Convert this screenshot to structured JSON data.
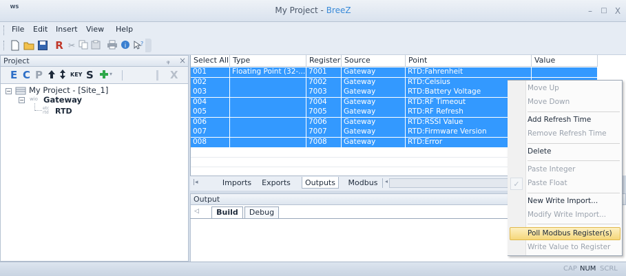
{
  "window": {
    "logo": "WS",
    "title_prefix": "My Project - ",
    "title_app": "BreeZ",
    "minimize": "–",
    "maximize": "□",
    "close": "X"
  },
  "menu": [
    "File",
    "Edit",
    "Insert",
    "View",
    "Help"
  ],
  "toolbar_icons": [
    "new-icon",
    "open-icon",
    "save-icon",
    "r-icon",
    "cut-icon",
    "copy-icon",
    "paste-icon",
    "print-icon",
    "about-icon",
    "help-icon"
  ],
  "project_panel": {
    "title": "Project",
    "pin": "ᵩ",
    "close": "×",
    "tools": {
      "e": "E",
      "c": "C",
      "p": "P",
      "key": "KEY",
      "s": "S",
      "x": "X"
    },
    "tree": {
      "root": "My Project - [Site_1]",
      "gateway_prefix": "wio",
      "gateway": "Gateway",
      "child_prefix": "etc rtd",
      "child": "RTD"
    }
  },
  "grid": {
    "columns": [
      "Select All",
      "Type",
      "Register",
      "Source",
      "Point",
      "Value"
    ],
    "rows": [
      {
        "id": "001",
        "type": "Floating Point (32-...",
        "register": "7001",
        "source": "Gateway",
        "point": "RTD:Fahrenheit",
        "value": ""
      },
      {
        "id": "002",
        "type": "",
        "register": "7002",
        "source": "Gateway",
        "point": "RTD:Celsius",
        "value": ""
      },
      {
        "id": "003",
        "type": "",
        "register": "7003",
        "source": "Gateway",
        "point": "RTD:Battery Voltage",
        "value": ""
      },
      {
        "id": "004",
        "type": "",
        "register": "7004",
        "source": "Gateway",
        "point": "RTD:RF Timeout",
        "value": ""
      },
      {
        "id": "005",
        "type": "",
        "register": "7005",
        "source": "Gateway",
        "point": "RTD:RF Refresh",
        "value": ""
      },
      {
        "id": "006",
        "type": "",
        "register": "7006",
        "source": "Gateway",
        "point": "RTD:RSSI Value",
        "value": ""
      },
      {
        "id": "007",
        "type": "",
        "register": "7007",
        "source": "Gateway",
        "point": "RTD:Firmware Version",
        "value": ""
      },
      {
        "id": "008",
        "type": "",
        "register": "7008",
        "source": "Gateway",
        "point": "RTD:Error",
        "value": ""
      }
    ]
  },
  "sheet_tabs": [
    "Imports",
    "Exports",
    "Outputs",
    "Modbus"
  ],
  "output_panel": {
    "title": "Output",
    "tabs": [
      "Build",
      "Debug"
    ]
  },
  "status": {
    "cap": "CAP",
    "num": "NUM",
    "scrl": "SCRL"
  },
  "context_menu": {
    "check": "✓",
    "items": [
      {
        "label": "Move Up",
        "enabled": false
      },
      {
        "label": "Move Down",
        "enabled": false
      },
      {
        "label": "Add Refresh Time",
        "enabled": true
      },
      {
        "label": "Remove Refresh Time",
        "enabled": false
      },
      {
        "label": "Delete",
        "enabled": true
      },
      {
        "label": "Paste Integer",
        "enabled": false
      },
      {
        "label": "Paste Float",
        "enabled": false
      },
      {
        "label": "New Write Import...",
        "enabled": true
      },
      {
        "label": "Modify Write Import...",
        "enabled": false
      },
      {
        "label": "Poll Modbus Register(s)",
        "enabled": true
      },
      {
        "label": "Write Value to Register",
        "enabled": false
      }
    ]
  },
  "colors": {
    "selection": "#3399ff",
    "highlight": "#f5d77a",
    "accent": "#3a8ad8"
  }
}
